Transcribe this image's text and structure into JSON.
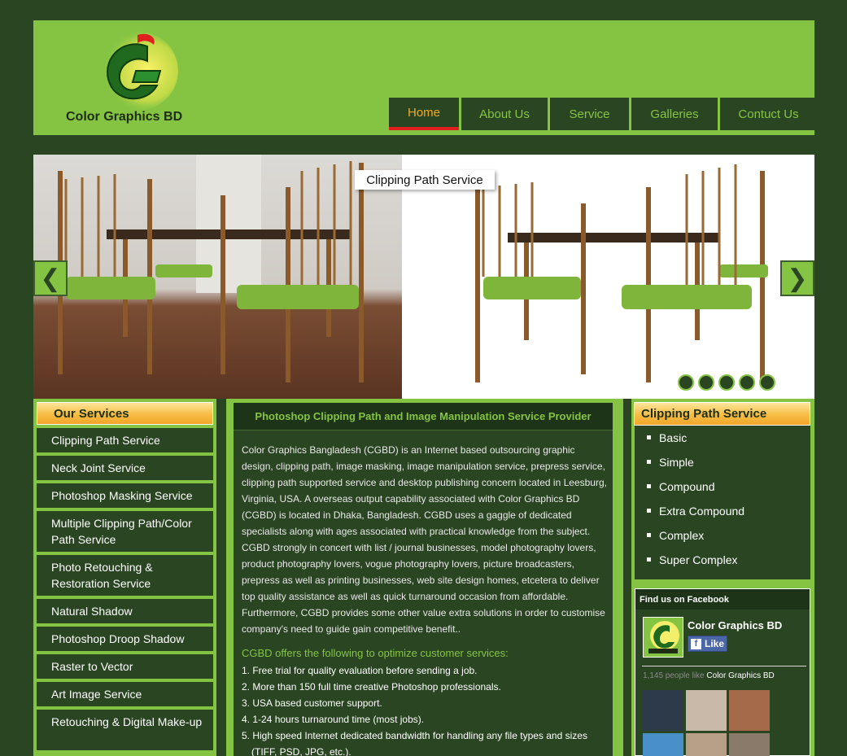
{
  "brand": {
    "name": "Color Graphics BD",
    "colors": {
      "accent": "#85c443",
      "dark": "#2a4522",
      "active": "#f2a92a",
      "active_bar": "#e0201e"
    }
  },
  "nav": {
    "items": [
      {
        "label": "Home",
        "active": true
      },
      {
        "label": "About Us"
      },
      {
        "label": "Service"
      },
      {
        "label": "Galleries"
      },
      {
        "label": "Contuct Us"
      }
    ]
  },
  "slider": {
    "caption": "Clipping Path Service",
    "prev_icon": "chevron-left-icon",
    "next_icon": "chevron-right-icon",
    "prev_glyph": "❮",
    "next_glyph": "❯",
    "slide_count": 5
  },
  "left": {
    "title": "Our Services",
    "items": [
      "Clipping Path Service",
      "Neck Joint Service",
      "Photoshop Masking Service",
      "Multiple Clipping Path/Color Path Service",
      "Photo Retouching & Restoration Service",
      "Natural Shadow",
      "Photoshop Droop Shadow",
      "Raster to Vector",
      "Art Image Service",
      "Retouching & Digital Make-up"
    ]
  },
  "center": {
    "title": "Photoshop Clipping Path and Image Manipulation Service Provider",
    "intro": "Color Graphics Bangladesh (CGBD) is an Internet based outsourcing graphic design, clipping path, image masking, image manipulation service, prepress service, clipping path supported service and desktop publishing concern located in Leesburg, Virginia, USA. A overseas output capability associated with Color Graphics BD (CGBD) is located in Dhaka, Bangladesh. CGBD uses a gaggle of dedicated specialists along with ages associated with practical knowledge from the subject. CGBD strongly in concert with list / journal businesses, model photography lovers, product photography lovers, vogue photography lovers, picture broadcasters, prepress as well as printing businesses, web site design homes, etcetera to deliver top quality assistance as well as quick turnaround occasion from affordable. Furthermore, CGBD provides some other value extra solutions in order to customise company's need to guide gain competitive benefit..",
    "offer_title": "CGBD offers the following to optimize customer services:",
    "offers": [
      "1. Free trial for quality evaluation before sending a job.",
      "2. More than 150 full time creative Photoshop professionals.",
      "3. USA based customer support.",
      "4. 1-24 hours turnaround time (most jobs).",
      "5. High speed Internet dedicated bandwidth for handling any file types and sizes (TIFF, PSD, JPG, etc.)."
    ]
  },
  "right": {
    "title": "Clipping Path Service",
    "items": [
      "Basic",
      "Simple",
      "Compound",
      "Extra Compound",
      "Complex",
      "Super Complex"
    ]
  },
  "facebook": {
    "header": "Find us on Facebook",
    "page_name": "Color Graphics BD",
    "like_label": "Like",
    "like_icon": "f",
    "count_text": "1,145 people like",
    "count_page": "Color Graphics BD",
    "fans": [
      {
        "name": "fan-photo-1",
        "color": "#2d3a4a"
      },
      {
        "name": "fan-photo-2",
        "color": "#c9b9a8"
      },
      {
        "name": "fan-photo-3",
        "color": "#a56a4a"
      },
      {
        "name": "fan-photo-4",
        "color": "#4a90c8"
      },
      {
        "name": "fan-photo-5",
        "color": "#b8a088"
      },
      {
        "name": "fan-photo-6",
        "color": "#8a7a6a"
      }
    ]
  }
}
